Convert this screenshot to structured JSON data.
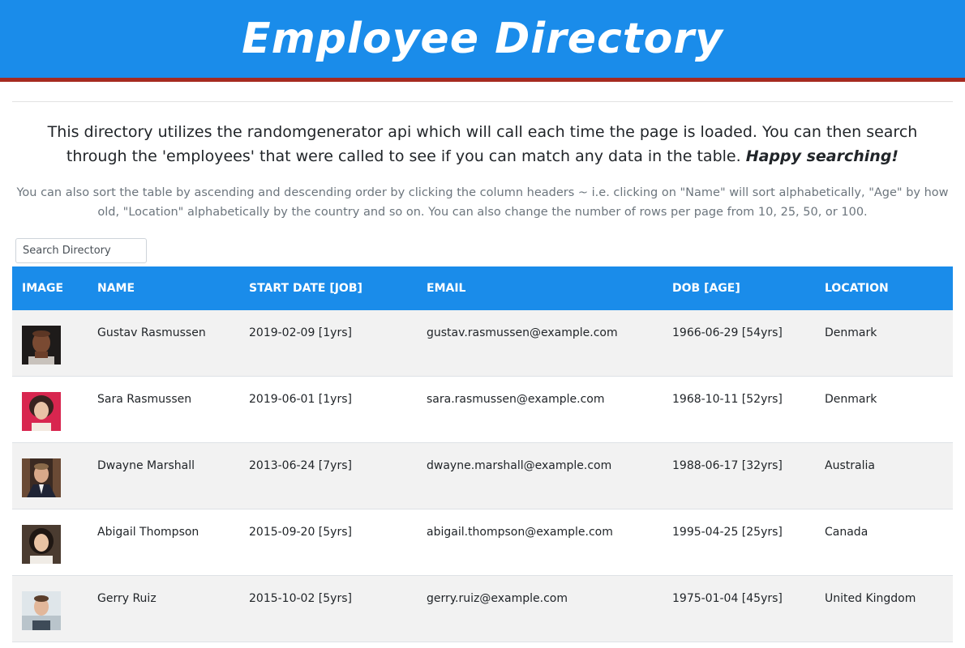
{
  "header": {
    "title": "Employee Directory"
  },
  "intro": {
    "text": "This directory utilizes the randomgenerator api which will call each time the page is loaded. You can then search through the 'employees' that were called to see if you can match any data in the table.",
    "emphasis": "Happy searching!"
  },
  "subtext": "You can also sort the table by ascending and descending order by clicking the column headers ~ i.e. clicking on \"Name\" will sort alphabetically, \"Age\" by how old, \"Location\" alphabetically by the country and so on. You can also change the number of rows per page from 10, 25, 50, or 100.",
  "search": {
    "placeholder": "Search Directory",
    "value": ""
  },
  "table": {
    "headers": {
      "image": "Image",
      "name": "Name",
      "start": "Start Date [Job]",
      "email": "Email",
      "dob": "DOB [Age]",
      "location": "Location"
    },
    "rows": [
      {
        "name": "Gustav Rasmussen",
        "start": "2019-02-09 [1yrs]",
        "email": "gustav.rasmussen@example.com",
        "dob": "1966-06-29 [54yrs]",
        "location": "Denmark"
      },
      {
        "name": "Sara Rasmussen",
        "start": "2019-06-01 [1yrs]",
        "email": "sara.rasmussen@example.com",
        "dob": "1968-10-11 [52yrs]",
        "location": "Denmark"
      },
      {
        "name": "Dwayne Marshall",
        "start": "2013-06-24 [7yrs]",
        "email": "dwayne.marshall@example.com",
        "dob": "1988-06-17 [32yrs]",
        "location": "Australia"
      },
      {
        "name": "Abigail Thompson",
        "start": "2015-09-20 [5yrs]",
        "email": "abigail.thompson@example.com",
        "dob": "1995-04-25 [25yrs]",
        "location": "Canada"
      },
      {
        "name": "Gerry Ruiz",
        "start": "2015-10-02 [5yrs]",
        "email": "gerry.ruiz@example.com",
        "dob": "1975-01-04 [45yrs]",
        "location": "United Kingdom"
      }
    ]
  },
  "colors": {
    "header_bg": "#1a8cea",
    "header_border": "#a52a20",
    "row_stripe": "#f2f2f2"
  }
}
